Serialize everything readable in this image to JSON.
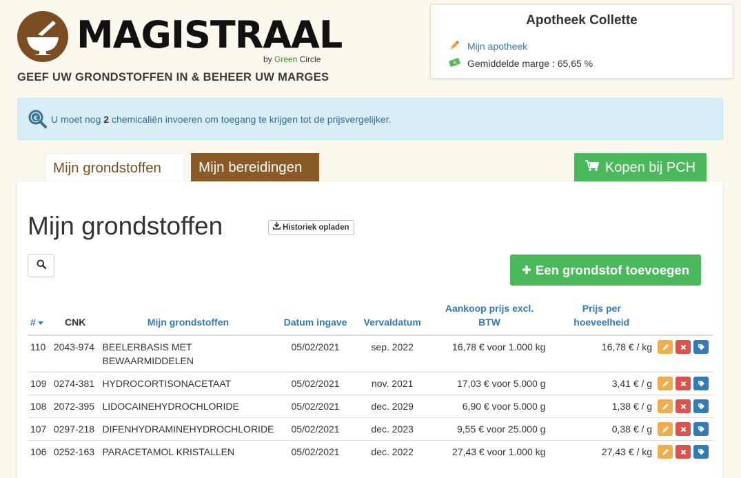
{
  "brand": {
    "name": "MAGISTRAAL",
    "by_prefix": "by ",
    "by_green": "Green",
    "by_suffix": " Circle",
    "tagline": "GEEF UW GRONDSTOFFEN IN & BEHEER UW MARGES",
    "logo_color": "#7a4e22"
  },
  "pharmacy": {
    "name": "Apotheek Collette",
    "link_label": "Mijn apotheek",
    "margin_label": "Gemiddelde marge : 65,65 %"
  },
  "alert": {
    "before": "U moet nog ",
    "count": "2",
    "after": " chemicaliën invoeren om toegang te krijgen tot de prijsvergelijker."
  },
  "tabs": [
    {
      "label": "Mijn grondstoffen",
      "active": true
    },
    {
      "label": "Mijn bereidingen",
      "active": false
    }
  ],
  "buy_button": "Kopen bij PCH",
  "main": {
    "title": "Mijn grondstoffen",
    "history_button": "Historiek opladen",
    "add_button": "Een grondstof toevoegen"
  },
  "table": {
    "headers": {
      "num": "#",
      "cnk": "CNK",
      "name": "Mijn grondstoffen",
      "date": "Datum ingave",
      "expiry": "Vervaldatum",
      "price_line1": "Aankoop prijs excl.",
      "price_line2": "BTW",
      "unit_line1": "Prijs per",
      "unit_line2": "hoeveelheid"
    },
    "rows": [
      {
        "num": "110",
        "cnk": "2043-974",
        "name": "BEELERBASIS MET BEWAARMIDDELEN",
        "date": "05/02/2021",
        "expiry": "sep. 2022",
        "price": "16,78 € voor 1.000 kg",
        "unit": "16,78 € / kg"
      },
      {
        "num": "109",
        "cnk": "0274-381",
        "name": "HYDROCORTISONACETAAT",
        "date": "05/02/2021",
        "expiry": "nov. 2021",
        "price": "17,03 € voor 5.000 g",
        "unit": "3,41 € / g"
      },
      {
        "num": "108",
        "cnk": "2072-395",
        "name": "LIDOCAINEHYDROCHLORIDE",
        "date": "05/02/2021",
        "expiry": "dec. 2029",
        "price": "6,90 € voor 5.000 g",
        "unit": "1,38 € / g"
      },
      {
        "num": "107",
        "cnk": "0297-218",
        "name": "DIFENHYDRAMINEHYDROCHLORIDE",
        "date": "05/02/2021",
        "expiry": "dec. 2023",
        "price": "9,55 € voor 25.000 g",
        "unit": "0,38 € / g"
      },
      {
        "num": "106",
        "cnk": "0252-163",
        "name": "PARACETAMOL KRISTALLEN",
        "date": "05/02/2021",
        "expiry": "dec. 2022",
        "price": "27,43 € voor 1.000 kg",
        "unit": "27,43 € / kg"
      }
    ]
  },
  "colors": {
    "background": "#fdf8ee",
    "green": "#4cb85c",
    "brown": "#8a5a26",
    "link": "#337ab7",
    "edit": "#f0ad4e",
    "delete": "#d9534f",
    "tag": "#337ab7"
  },
  "icons": [
    "mortar-pestle-icon",
    "pencil-icon",
    "money-icon",
    "search-euro-icon",
    "cart-icon",
    "download-icon",
    "search-icon",
    "plus-icon",
    "edit-icon",
    "delete-icon",
    "tag-icon",
    "sort-caret-icon"
  ]
}
